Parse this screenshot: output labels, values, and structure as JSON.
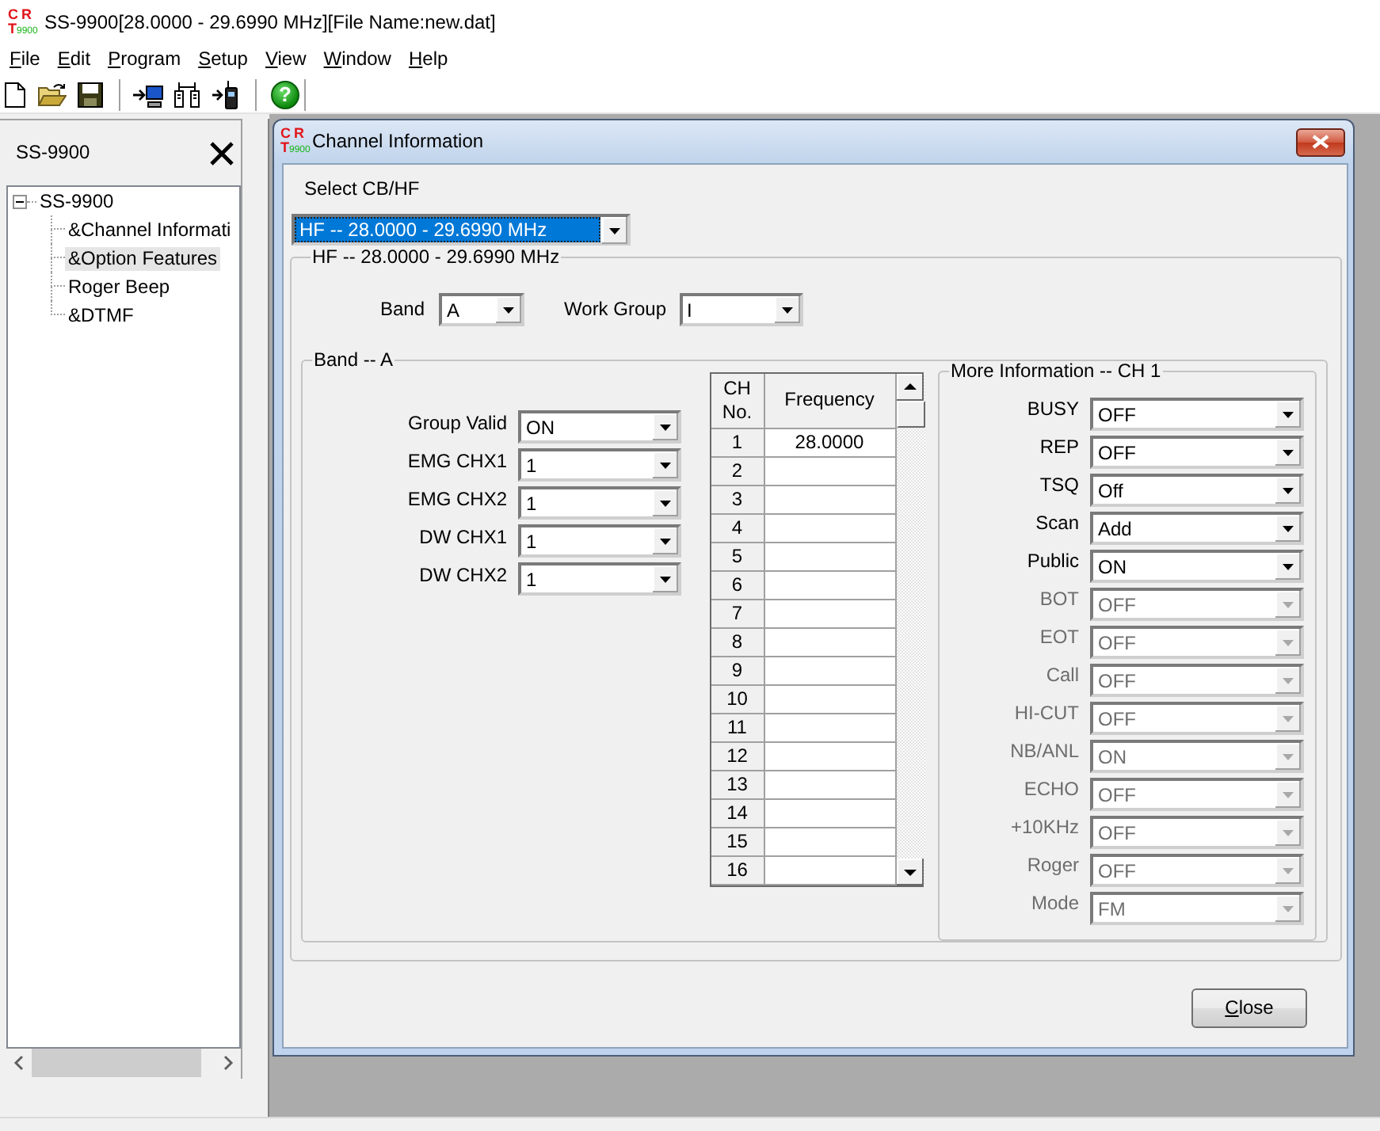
{
  "window": {
    "logo": {
      "top": "CR",
      "bottom": "T",
      "model": "9900"
    },
    "title": "SS-9900[28.0000 - 29.6990 MHz][File Name:new.dat]"
  },
  "menu": [
    "File",
    "Edit",
    "Program",
    "Setup",
    "View",
    "Window",
    "Help"
  ],
  "toolbar": {
    "help_button": "?"
  },
  "sidebar": {
    "title": "SS-9900",
    "tree": [
      {
        "label": "SS-9900",
        "selected": false,
        "expanded": true,
        "children": [
          {
            "label": "&Channel Informati",
            "selected": false
          },
          {
            "label": "&Option Features",
            "selected": true
          },
          {
            "label": "Roger Beep",
            "selected": false
          },
          {
            "label": "&DTMF",
            "selected": false
          }
        ]
      }
    ]
  },
  "dialog": {
    "logo": {
      "top": "CR",
      "bottom": "T",
      "model": "9900"
    },
    "title": "Channel Information",
    "select_label": "Select CB/HF",
    "select": {
      "value": "HF -- 28.0000 - 29.6990 MHz",
      "focused": true
    },
    "group": {
      "title": "HF -- 28.0000 - 29.6990 MHz",
      "band": {
        "label": "Band",
        "value": "A"
      },
      "work_group": {
        "label": "Work Group",
        "value": "I"
      },
      "band_group": {
        "title": "Band -- A",
        "settings": [
          {
            "label": "Group Valid",
            "value": "ON"
          },
          {
            "label": "EMG CHX1",
            "value": "1"
          },
          {
            "label": "EMG CHX2",
            "value": "1"
          },
          {
            "label": "DW CHX1",
            "value": "1"
          },
          {
            "label": "DW CHX2",
            "value": "1"
          }
        ],
        "channel_table": {
          "columns": [
            "CH No.",
            "Frequency"
          ],
          "rows": [
            {
              "ch": "1",
              "frequency": "28.0000"
            },
            {
              "ch": "2"
            },
            {
              "ch": "3"
            },
            {
              "ch": "4"
            },
            {
              "ch": "5"
            },
            {
              "ch": "6"
            },
            {
              "ch": "7"
            },
            {
              "ch": "8"
            },
            {
              "ch": "9"
            },
            {
              "ch": "10"
            },
            {
              "ch": "11"
            },
            {
              "ch": "12"
            },
            {
              "ch": "13"
            },
            {
              "ch": "14"
            },
            {
              "ch": "15"
            },
            {
              "ch": "16"
            }
          ]
        },
        "more_information": {
          "title": "More Information -- CH 1",
          "fields": [
            {
              "label": "BUSY",
              "value": "OFF",
              "disabled": false
            },
            {
              "label": "REP",
              "value": "OFF",
              "disabled": false
            },
            {
              "label": "TSQ",
              "value": "Off",
              "disabled": false
            },
            {
              "label": "Scan",
              "value": "Add",
              "disabled": false
            },
            {
              "label": "Public",
              "value": "ON",
              "disabled": false
            },
            {
              "label": "BOT",
              "value": "OFF",
              "disabled": true
            },
            {
              "label": "EOT",
              "value": "OFF",
              "disabled": true
            },
            {
              "label": "Call",
              "value": "OFF",
              "disabled": true
            },
            {
              "label": "HI-CUT",
              "value": "OFF",
              "disabled": true
            },
            {
              "label": "NB/ANL",
              "value": "ON",
              "disabled": true
            },
            {
              "label": "ECHO",
              "value": "OFF",
              "disabled": true
            },
            {
              "label": "+10KHz",
              "value": "OFF",
              "disabled": true
            },
            {
              "label": "Roger",
              "value": "OFF",
              "disabled": true
            },
            {
              "label": "Mode",
              "value": "FM",
              "disabled": true
            }
          ]
        }
      }
    },
    "buttons": [
      "Close"
    ]
  }
}
